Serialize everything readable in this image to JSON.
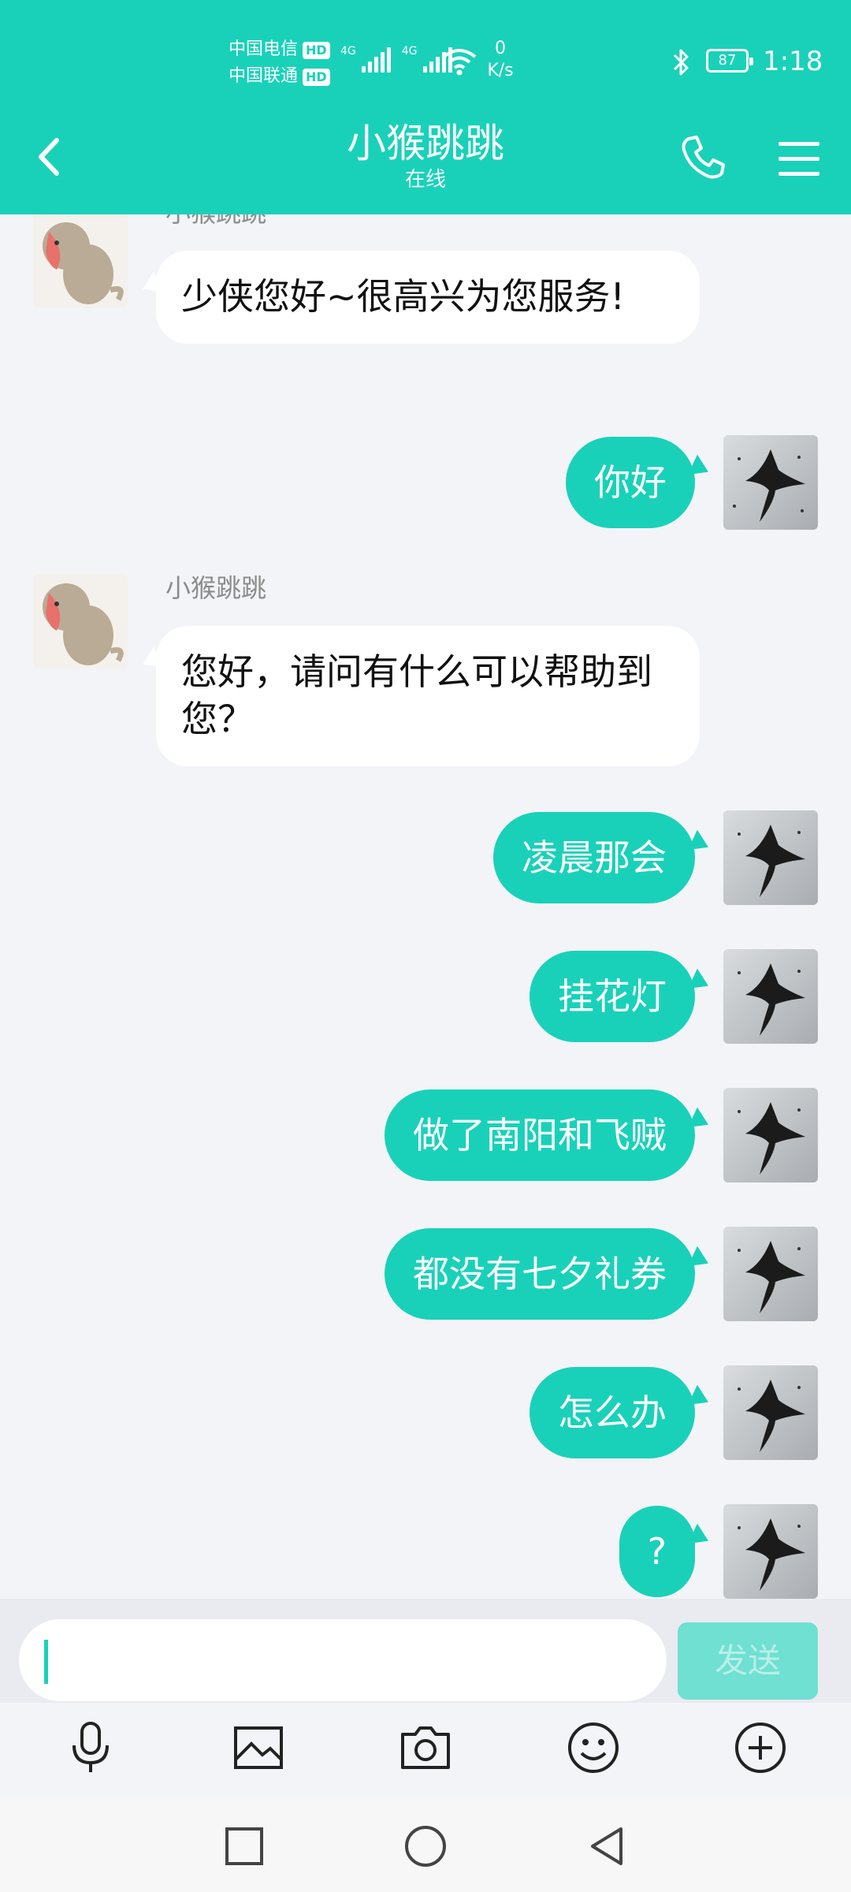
{
  "status_bar": {
    "carrier1": "中国电信",
    "carrier2": "中国联通",
    "hd": "HD",
    "net1": "4G",
    "net2": "4G",
    "speed_value": "0",
    "speed_unit": "K/s",
    "battery": "87",
    "time": "1:18"
  },
  "header": {
    "title": "小猴跳跳",
    "subtitle": "在线"
  },
  "messages": [
    {
      "side": "in",
      "sender": "小猴跳跳",
      "text": "少侠您好~很高兴为您服务!"
    },
    {
      "side": "out",
      "text": "你好"
    },
    {
      "side": "in",
      "sender": "小猴跳跳",
      "text": "您好，请问有什么可以帮助到您？"
    },
    {
      "side": "out",
      "text": "凌晨那会"
    },
    {
      "side": "out",
      "text": "挂花灯"
    },
    {
      "side": "out",
      "text": "做了南阳和飞贼"
    },
    {
      "side": "out",
      "text": "都没有七夕礼券"
    },
    {
      "side": "out",
      "text": "怎么办"
    },
    {
      "side": "out",
      "text": "?"
    }
  ],
  "input": {
    "value": "",
    "send_label": "发送"
  },
  "toolbar_icons": [
    "microphone-icon",
    "image-icon",
    "camera-icon",
    "emoji-icon",
    "plus-icon"
  ],
  "colors": {
    "accent": "#19d1b9",
    "background": "#f3f4f8",
    "bubble_in": "#ffffff",
    "send_disabled": "#6fe0d2"
  }
}
